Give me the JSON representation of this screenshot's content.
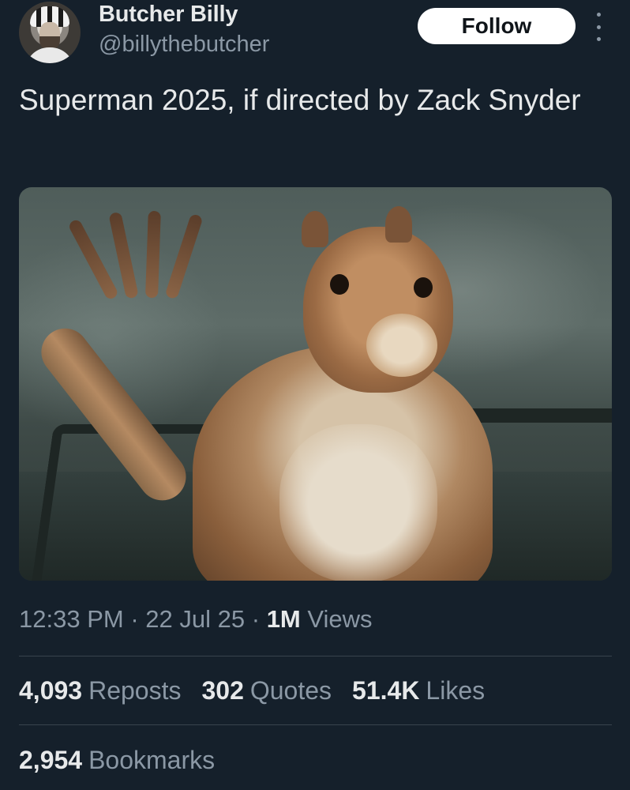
{
  "author": {
    "display_name": "Butcher Billy",
    "handle": "@billythebutcher"
  },
  "follow_label": "Follow",
  "post": {
    "text": "Superman 2025, if directed by Zack Snyder"
  },
  "meta": {
    "time": "12:33 PM",
    "separator": "·",
    "date": "22 Jul 25",
    "views_count": "1M",
    "views_label": "Views"
  },
  "stats": {
    "reposts_count": "4,093",
    "reposts_label": "Reposts",
    "quotes_count": "302",
    "quotes_label": "Quotes",
    "likes_count": "51.4K",
    "likes_label": "Likes",
    "bookmarks_count": "2,954",
    "bookmarks_label": "Bookmarks"
  },
  "icons": {
    "more": "more-vertical-icon"
  },
  "colors": {
    "background": "#15202b",
    "text_primary": "#e7e9ea",
    "text_secondary": "#8b98a5",
    "divider": "#38444d",
    "follow_bg": "#ffffff"
  }
}
